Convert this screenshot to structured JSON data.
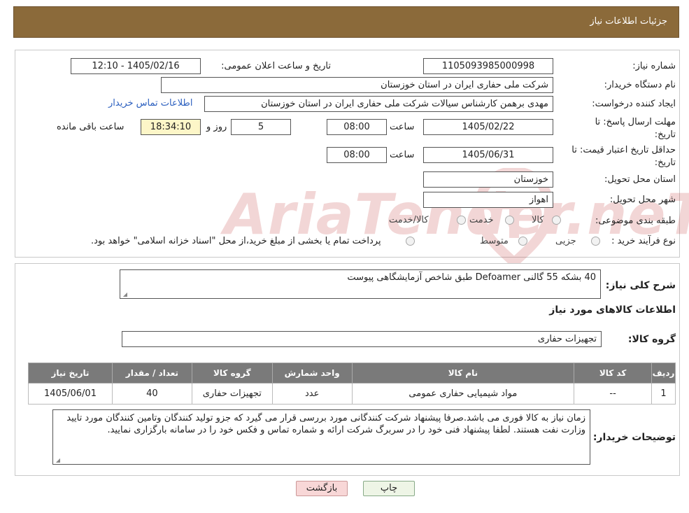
{
  "header": {
    "title": "جزئیات اطلاعات نیاز"
  },
  "form": {
    "need_number_label": "شماره نیاز:",
    "need_number": "1105093985000998",
    "announce_label": "تاریخ و ساعت اعلان عمومی:",
    "announce_value": "1405/02/16 - 12:10",
    "buyer_org_label": "نام دستگاه خریدار:",
    "buyer_org": "شرکت ملی حفاری ایران در استان خوزستان",
    "creator_label": "ایجاد کننده درخواست:",
    "creator": "مهدی برهمن کارشناس سیالات شرکت ملی حفاری ایران در استان خوزستان",
    "contact_link": "اطلاعات تماس خریدار",
    "deadline_label": "مهلت ارسال پاسخ: تا تاریخ:",
    "deadline_date": "1405/02/22",
    "time_label": "ساعت",
    "deadline_time": "08:00",
    "days_value": "5",
    "days_label": "روز و",
    "remaining_time": "18:34:10",
    "remaining_label": "ساعت باقی مانده",
    "validity_label": "حداقل تاریخ اعتبار قیمت: تا تاریخ:",
    "validity_date": "1405/06/31",
    "validity_time": "08:00",
    "province_label": "استان محل تحویل:",
    "province": "خوزستان",
    "city_label": "شهر محل تحویل:",
    "city": "اهواز",
    "category_label": "طبقه بندی موضوعی:",
    "category_options": [
      "کالا",
      "خدمت",
      "کالا/خدمت"
    ],
    "process_label": "نوع فرآیند خرید :",
    "process_options": [
      "جزیی",
      "متوسط"
    ],
    "process_note": "پرداخت تمام یا بخشی از مبلغ خرید،از محل \"اسناد خزانه اسلامی\" خواهد بود."
  },
  "watermark": {
    "text": "AriaTender.neT"
  },
  "details": {
    "summary_label": "شرح کلی نیاز:",
    "summary": "40 بشکه 55 گالنی Defoamer طبق شاخص آزمایشگاهی پیوست",
    "goods_info_title": "اطلاعات کالاهای مورد نیاز",
    "goods_group_label": "گروه کالا:",
    "goods_group": "تجهیزات حفاری",
    "table": {
      "headers": [
        "ردیف",
        "کد کالا",
        "نام کالا",
        "واحد شمارش",
        "گروه کالا",
        "تعداد / مقدار",
        "تاریخ نیاز"
      ],
      "rows": [
        [
          "1",
          "--",
          "مواد شیمیایی حفاری عمومی",
          "عدد",
          "تجهیزات حفاری",
          "40",
          "1405/06/01"
        ]
      ]
    },
    "buyer_notes_label": "توضیحات خریدار:",
    "buyer_notes": "زمان نیاز به کالا فوری می باشد.صرفا پیشنهاد شرکت کنندگانی مورد بررسی قرار می گیرد که جزو تولید کنندگان وتامین کنندگان مورد تایید وزارت نفت هستند. لطفا پیشنهاد فنی خود را در سربرگ شرکت ارائه و شماره تماس و فکس خود را در سامانه بارگزاری نمایید."
  },
  "buttons": {
    "print": "چاپ",
    "back": "بازگشت"
  }
}
